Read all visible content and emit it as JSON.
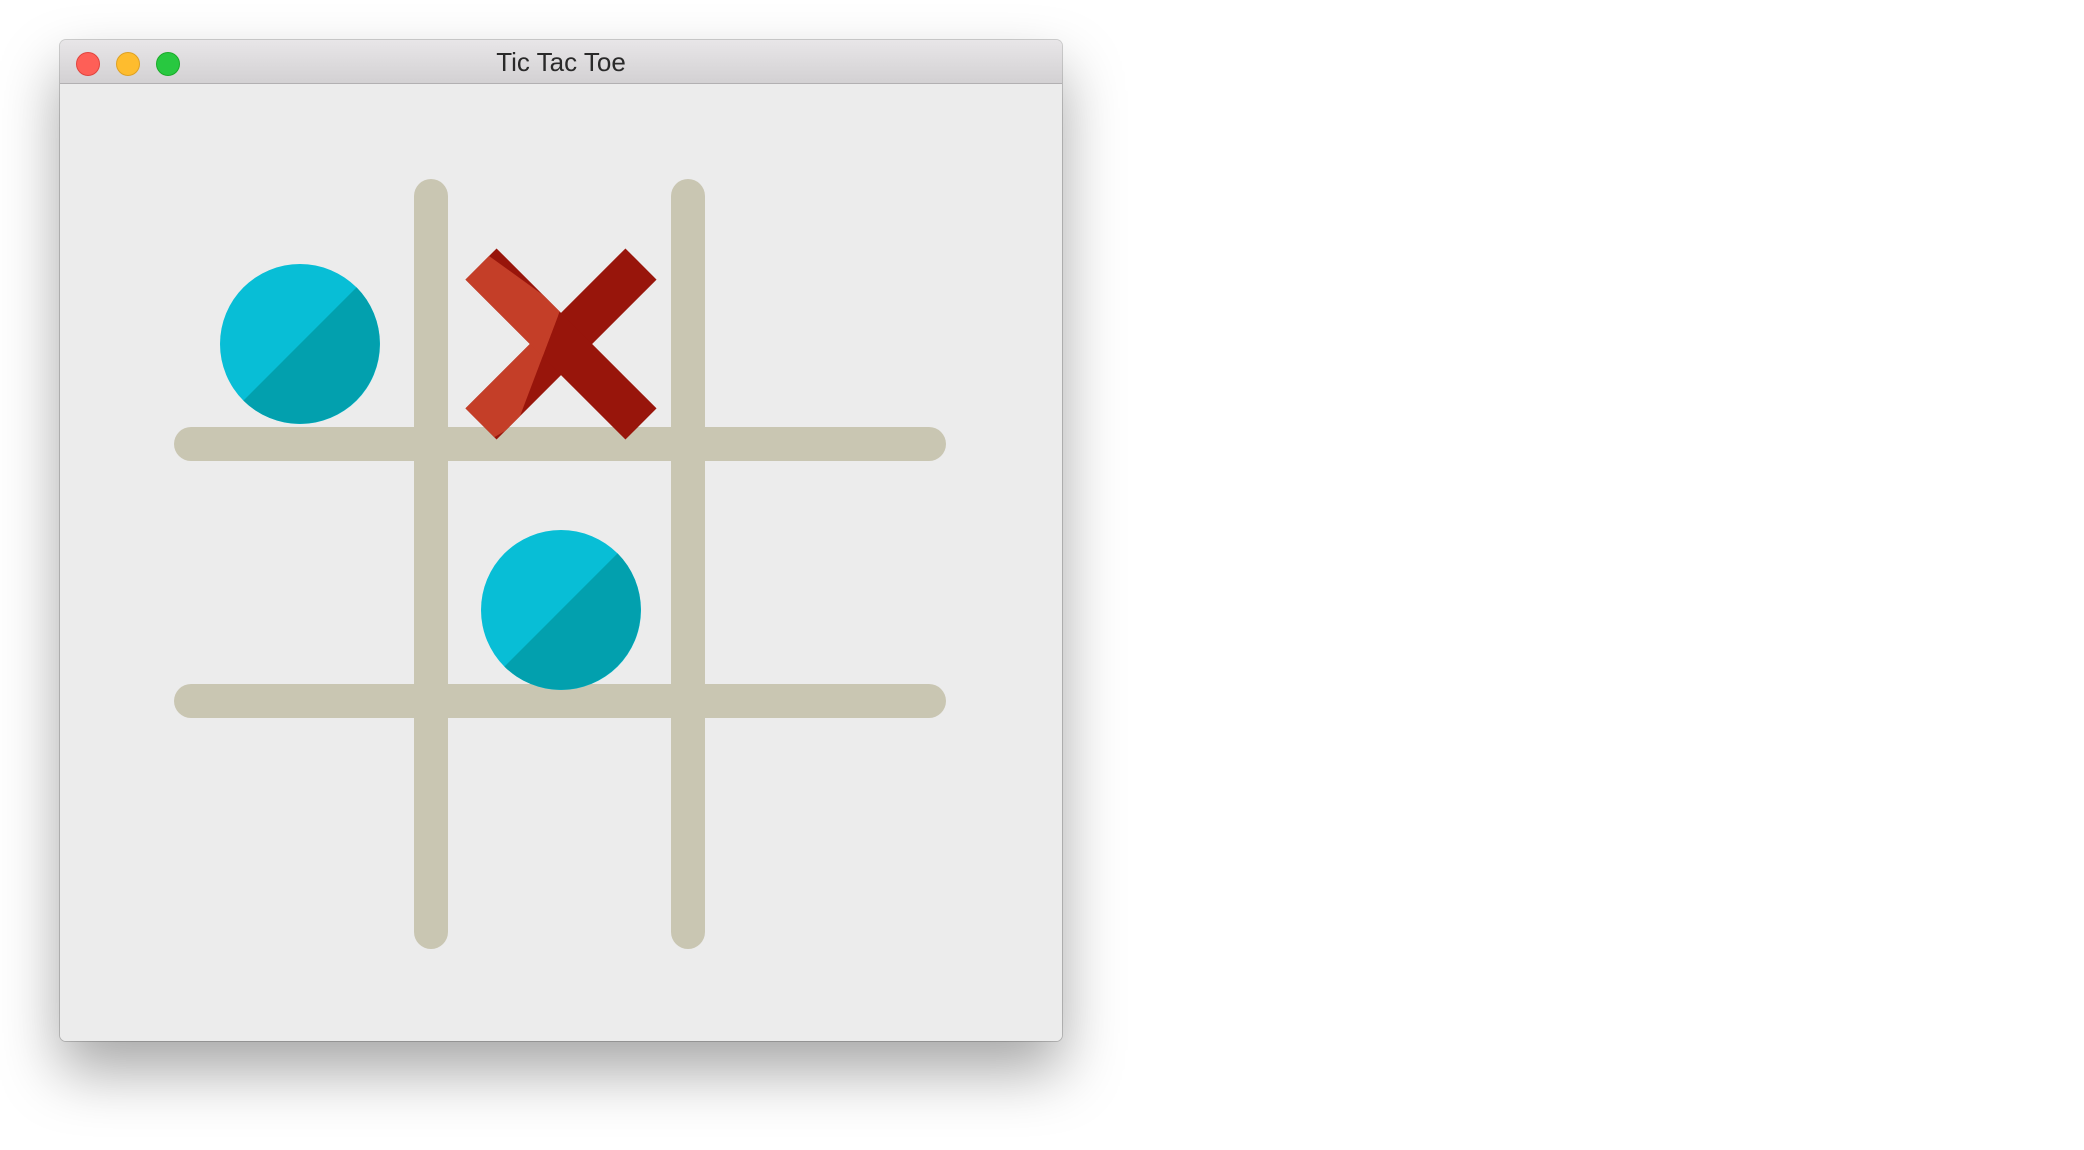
{
  "window": {
    "title": "Tic Tac Toe"
  },
  "colors": {
    "grid": "#c9c6b2",
    "o_light": "#08bed6",
    "o_dark": "#02a0ae",
    "x_light": "#c43e28",
    "x_dark": "#98150b",
    "background": "#ececec"
  },
  "board": [
    [
      "O",
      "X",
      ""
    ],
    [
      "",
      "O",
      ""
    ],
    [
      "",
      "",
      ""
    ]
  ]
}
